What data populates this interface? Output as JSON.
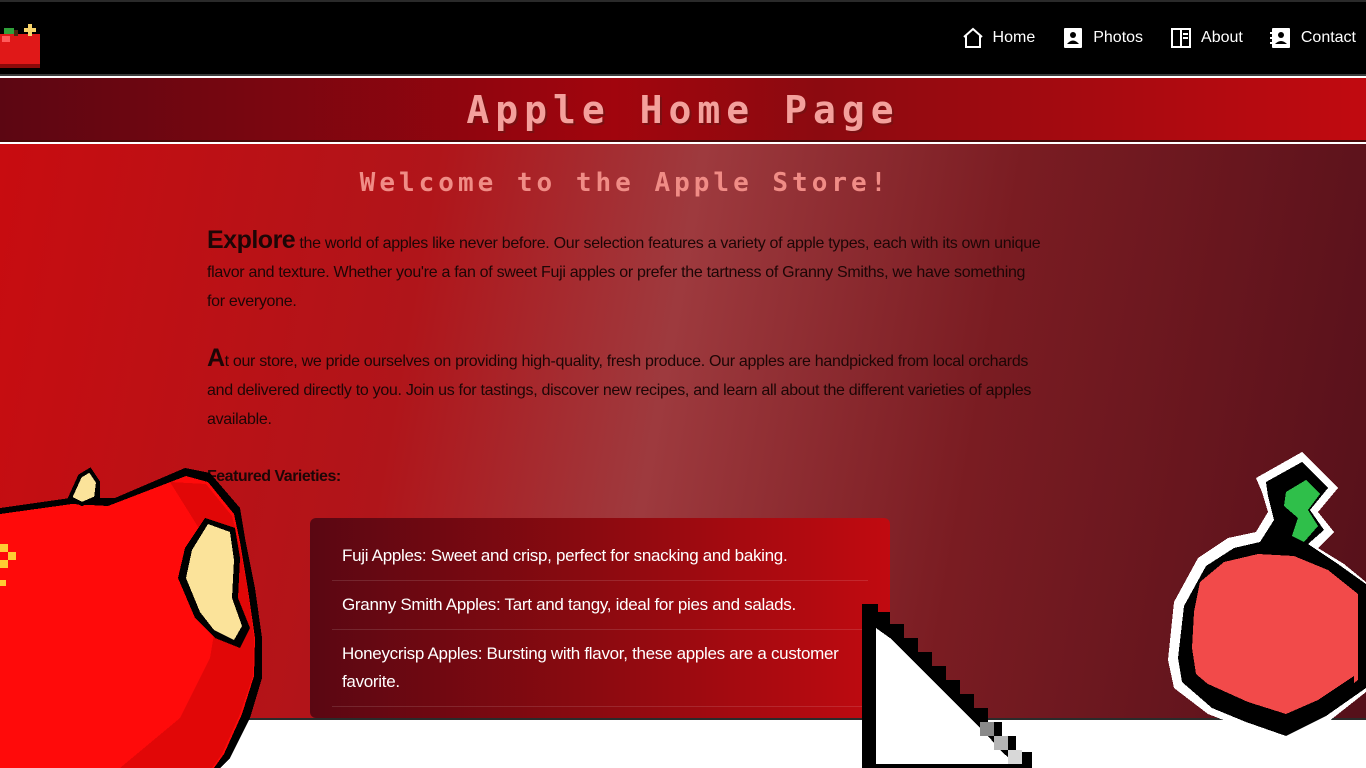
{
  "nav": {
    "items": [
      {
        "label": "Home",
        "icon": "home-icon"
      },
      {
        "label": "Photos",
        "icon": "photo-icon"
      },
      {
        "label": "About",
        "icon": "book-icon"
      },
      {
        "label": "Contact",
        "icon": "contact-icon"
      }
    ]
  },
  "banner": {
    "title": "Apple Home Page"
  },
  "main": {
    "welcome": "Welcome to the Apple Store!",
    "p1_lead": "Explore",
    "p1_text": " the world of apples like never before. Our selection features a variety of apple types, each with its own unique flavor and texture. Whether you're a fan of sweet Fuji apples or prefer the tartness of Granny Smiths, we have something for everyone.",
    "p2_lead": "A",
    "p2_text": "t our store, we pride ourselves on providing high-quality, fresh produce. Our apples are handpicked from local orchards and delivered directly to you. Join us for tastings, discover new recipes, and learn all about the different varieties of apples available.",
    "featured_label": "Featured Varieties:",
    "varieties": [
      "Fuji Apples: Sweet and crisp, perfect for snacking and baking.",
      "Granny Smith Apples: Tart and tangy, ideal for pies and salads.",
      "Honeycrisp Apples: Bursting with flavor, these apples are a customer favorite."
    ]
  },
  "colors": {
    "accent": "#c10a10",
    "banner_text": "#f4a09c",
    "welcome_text": "#f08c86",
    "nav_bg": "#000000"
  }
}
